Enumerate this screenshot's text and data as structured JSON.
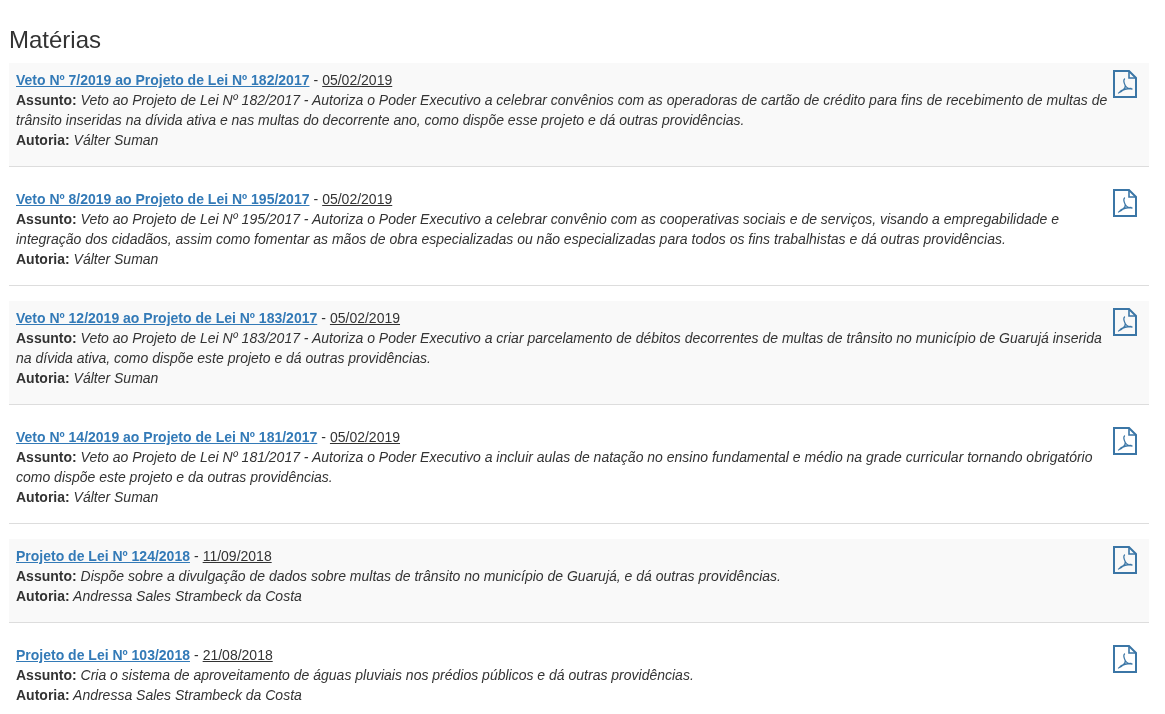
{
  "heading": "Matérias",
  "items": [
    {
      "title": "Veto Nº 7/2019 ao Projeto de Lei Nº 182/2017",
      "separator": "-",
      "date": "05/02/2019",
      "subject": "**Assunto:** Veto ao Projeto de Lei Nº 182/2017 - Autoriza o Poder Executivo a celebrar convênios com as operadoras de cartão de crédito para fins de recebimento de multas de trânsito inseridas na dívida ativa e nas multas do decorrente ano, como dispõe esse projeto e dá outras providências.",
      "author": "**Autoria:** Válter Suman"
    },
    {
      "title": "Veto Nº 8/2019 ao Projeto de Lei Nº 195/2017",
      "separator": "-",
      "date": "05/02/2019",
      "subject": "**Assunto:** Veto ao Projeto de Lei Nº 195/2017 - Autoriza o Poder Executivo a celebrar convênio com as cooperativas sociais e de serviços, visando a empregabilidade e integração dos cidadãos, assim como fomentar as mãos de obra especializadas ou não especializadas para todos os fins trabalhistas e dá outras providências.",
      "author": "**Autoria:** Válter Suman"
    },
    {
      "title": "Veto Nº 12/2019 ao Projeto de Lei Nº 183/2017",
      "separator": "-",
      "date": "05/02/2019",
      "subject": "**Assunto:** Veto ao Projeto de Lei Nº 183/2017 - Autoriza o Poder Executivo a criar parcelamento de débitos decorrentes de multas de trânsito no município de Guarujá inserida na dívida ativa, como dispõe este projeto e dá outras providências.",
      "author": "**Autoria:** Válter Suman"
    },
    {
      "title": "Veto Nº 14/2019 ao Projeto de Lei Nº 181/2017",
      "separator": "-",
      "date": "05/02/2019",
      "subject": "**Assunto:** Veto ao Projeto de Lei Nº 181/2017 - Autoriza o Poder Executivo a incluir aulas de natação no ensino fundamental e médio na grade curricular tornando obrigatório como dispõe este projeto e da outras providências.",
      "author": "**Autoria:** Válter Suman"
    },
    {
      "title": "Projeto de Lei Nº 124/2018",
      "separator": "-",
      "date": "11/09/2018",
      "subject": "**Assunto:** Dispõe sobre a divulgação de dados sobre multas de trânsito no município de Guarujá, e dá outras providências.",
      "author": "**Autoria:** Andressa Sales Strambeck da Costa"
    },
    {
      "title": "Projeto de Lei Nº 103/2018",
      "separator": "-",
      "date": "21/08/2018",
      "subject": "**Assunto:** Cria o sistema de aproveitamento de águas pluviais nos prédios públicos e dá outras providências.",
      "author": "**Autoria:** Andressa Sales Strambeck da Costa"
    }
  ]
}
